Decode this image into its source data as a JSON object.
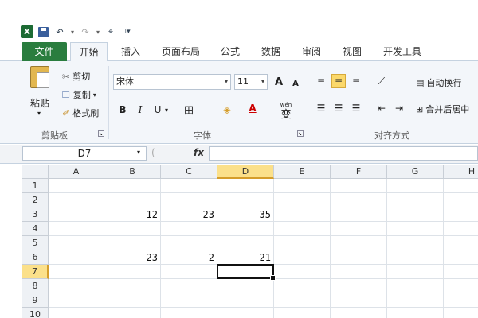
{
  "qat": {
    "logo": "X",
    "undo": "↶",
    "redo": "↷",
    "undo_dd": "▾",
    "redo_dd": "▾",
    "customize": "⌖",
    "more": "⁞▾"
  },
  "tabs": [
    {
      "label": "文件",
      "key": "file"
    },
    {
      "label": "开始",
      "key": "home"
    },
    {
      "label": "插入",
      "key": "insert"
    },
    {
      "label": "页面布局",
      "key": "layout"
    },
    {
      "label": "公式",
      "key": "formulas"
    },
    {
      "label": "数据",
      "key": "data"
    },
    {
      "label": "审阅",
      "key": "review"
    },
    {
      "label": "视图",
      "key": "view"
    },
    {
      "label": "开发工具",
      "key": "developer"
    }
  ],
  "ribbon": {
    "clipboard": {
      "label": "剪贴板",
      "paste": "粘贴",
      "cut": "剪切",
      "copy": "复制",
      "format_painter": "格式刷",
      "paste_dd": "▾",
      "copy_dd": "▾"
    },
    "font": {
      "label": "字体",
      "name": "宋体",
      "size": "11",
      "bold": "B",
      "italic": "I",
      "underline": "U",
      "underline_dd": "▾",
      "grow": "A",
      "shrink": "A",
      "border": "田",
      "fill": "◈",
      "color": "A",
      "phonetic": "wén",
      "phonetic_glyph": "变"
    },
    "alignment": {
      "label": "对齐方式",
      "wrap": "自动换行",
      "merge": "合并后居中"
    },
    "launcher_glyph": "↘"
  },
  "formula_bar": {
    "name_box": "D7",
    "fx": "fx",
    "value": "",
    "dropdown": "▾",
    "cancel": "("
  },
  "columns": [
    "A",
    "B",
    "C",
    "D",
    "E",
    "F",
    "G",
    "H"
  ],
  "rows": [
    "1",
    "2",
    "3",
    "4",
    "5",
    "6",
    "7",
    "8",
    "9",
    "10"
  ],
  "cells": {
    "B3": "12",
    "C3": "23",
    "D3": "35",
    "B6": "23",
    "C6": "2",
    "D6": "21"
  },
  "selected_cell": "D7",
  "colors": {
    "file_tab": "#2a7d3e",
    "selection_header": "#fbe08a"
  }
}
